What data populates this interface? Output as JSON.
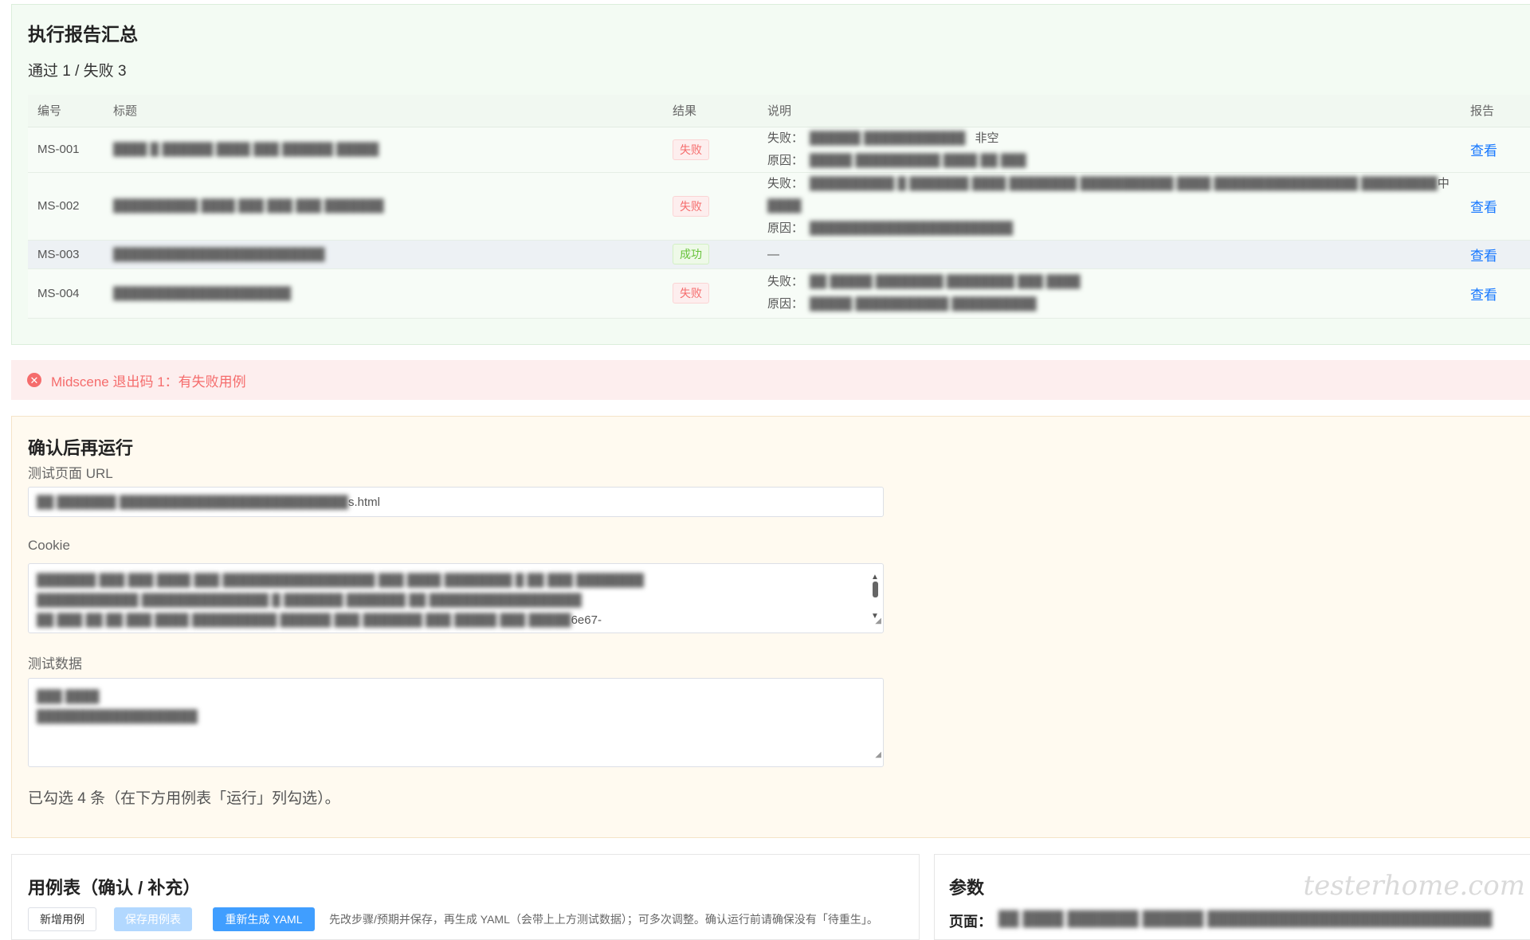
{
  "report": {
    "title": "执行报告汇总",
    "summary": "通过 1 / 失败 3",
    "headers": {
      "id": "编号",
      "title": "标题",
      "result": "结果",
      "desc": "说明",
      "report": "报告"
    },
    "rows": [
      {
        "id": "MS-001",
        "title": "████ █ ██████ ████ ███ ██████ █████",
        "result": "失败",
        "result_type": "fail",
        "fail_label": "失败：",
        "fail_text": "██████ ████████████",
        "fail_suffix": "非空",
        "reason_label": "原因：",
        "reason_text": "█████ ██████████ ████ ██ ███",
        "link": "查看"
      },
      {
        "id": "MS-002",
        "title": "██████████ ████ ███ ███ ███ ███████",
        "result": "失败",
        "result_type": "fail",
        "fail_label": "失败：",
        "fail_text": "██████████ █ ███████ ████ ████████ ███████████ ████ █████████████████ █████████",
        "fail_suffix": "中",
        "fail_cont": "████",
        "reason_label": "原因：",
        "reason_text": "████████████████████████",
        "link": "查看"
      },
      {
        "id": "MS-003",
        "title": "█████████████████████████",
        "result": "成功",
        "result_type": "success",
        "dash": "—",
        "link": "查看"
      },
      {
        "id": "MS-004",
        "title": "█████████████████████",
        "result": "失败",
        "result_type": "fail",
        "fail_label": "失败：",
        "fail_text": "██ █████ ████████ ████████ ███ ████",
        "reason_label": "原因：",
        "reason_text": "█████ ███████████ ██████████",
        "link": "查看"
      }
    ]
  },
  "alert": {
    "icon": "✕",
    "text": "Midscene 退出码 1：有失败用例"
  },
  "confirm": {
    "title": "确认后再运行",
    "url_label": "测试页面 URL",
    "url_value_blur": "██ ███████ ███████████████████████████",
    "url_value_suffix": "s.html",
    "cookie_label": "Cookie",
    "cookie_lines": [
      "███████ ███ ███ ████ ███ ██████████████████ ███ ████ ████████ █ ██ ███ ████████",
      "████████████ ███████████████ █ ███████ ███████ ██ ██████████████████",
      "██ ███ ██ ██ ███ ████ ██████████ ██████ ███ ███████ ███ █████ ███ █████"
    ],
    "cookie_suffix": "6e67-",
    "data_label": "测试数据",
    "data_lines": [
      "███ ████",
      "███████████████████"
    ],
    "selected_note": "已勾选 4 条（在下方用例表「运行」列勾选）。"
  },
  "cases": {
    "title": "用例表（确认 / 补充）",
    "add_button": "新增用例",
    "save_button": "保存用例表",
    "regen_button": "重新生成 YAML",
    "hint": "先改步骤/预期并保存，再生成 YAML（会带上上方测试数据）；可多次调整。确认运行前请确保没有「待重生」。"
  },
  "params": {
    "title": "参数",
    "page_label": "页面：",
    "page_value": "██ ████ ███████ ██████ ████████████████████████████"
  },
  "watermark": "testerhome.com"
}
